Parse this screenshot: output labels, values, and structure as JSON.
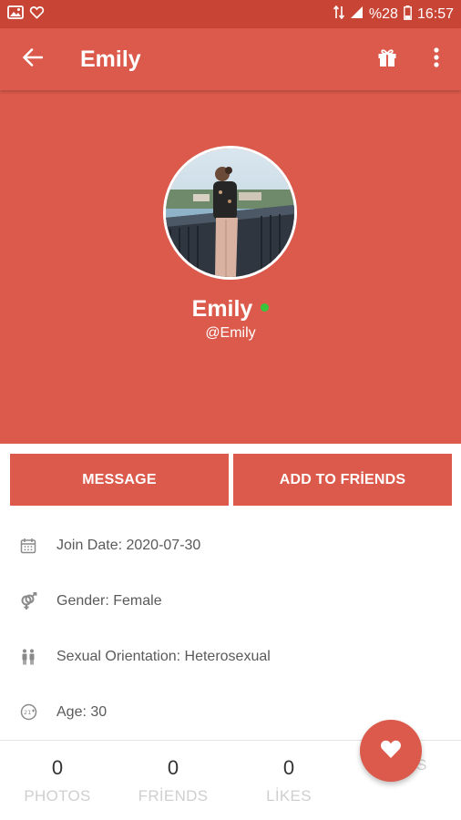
{
  "status_bar": {
    "battery": "%28",
    "time": "16:57",
    "icons": [
      "image-icon",
      "heart-outline-icon",
      "data-arrows-icon",
      "signal-icon",
      "battery-icon"
    ]
  },
  "app_bar": {
    "title": "Emily",
    "icons": [
      "arrow-back-icon",
      "gift-icon",
      "more-vert-icon"
    ]
  },
  "profile": {
    "name": "Emily",
    "handle": "@Emily",
    "online": true
  },
  "actions": {
    "message": "MESSAGE",
    "add_friend": "ADD TO FRİENDS"
  },
  "info": [
    {
      "icon": "calendar-icon",
      "text": "Join Date: 2020-07-30"
    },
    {
      "icon": "gender-icon",
      "text": "Gender: Female"
    },
    {
      "icon": "couple-icon",
      "text": "Sexual Orientation: Heterosexual"
    },
    {
      "icon": "age-icon",
      "text": "Age: 30"
    }
  ],
  "stats": [
    {
      "count": "0",
      "label": "PHOTOS"
    },
    {
      "count": "0",
      "label": "FRİENDS"
    },
    {
      "count": "0",
      "label": "LİKES"
    },
    {
      "count": "",
      "label": "GİFTS"
    }
  ],
  "colors": {
    "primary": "#db5a4b",
    "primary_dark": "#c84435",
    "online": "#38c53d"
  }
}
